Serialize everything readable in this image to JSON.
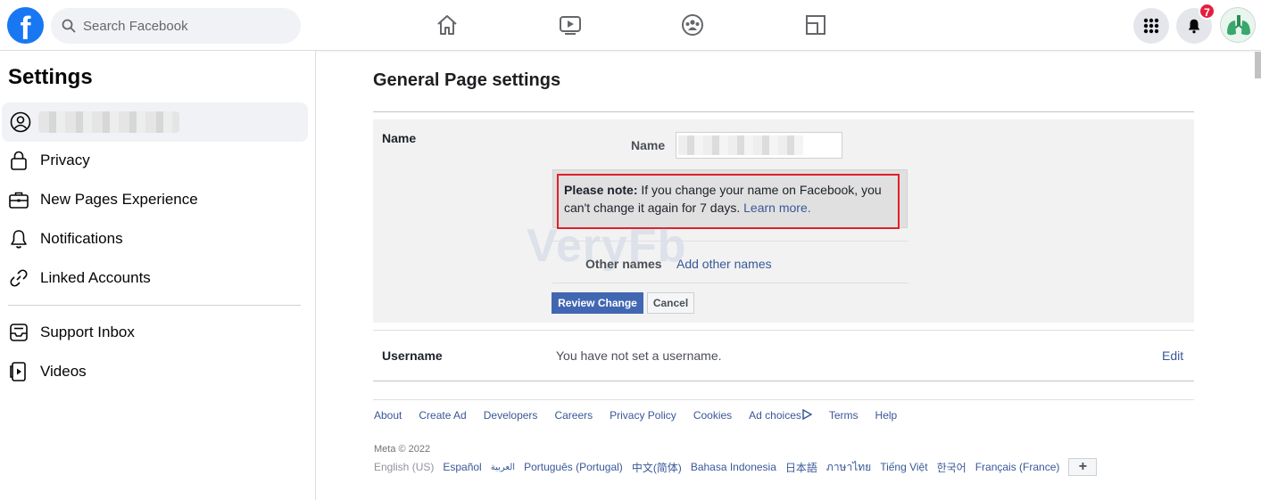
{
  "topbar": {
    "logo": "f",
    "search_placeholder": "Search Facebook",
    "notification_count": "7",
    "icons": [
      "home-icon",
      "watch-icon",
      "groups-icon",
      "gaming-icon",
      "menu-grid-icon",
      "bell-icon"
    ]
  },
  "sidebar": {
    "title": "Settings",
    "items": [
      {
        "label": "",
        "icon": "profile-icon",
        "active": true
      },
      {
        "label": "Privacy",
        "icon": "lock-icon"
      },
      {
        "label": "New Pages Experience",
        "icon": "briefcase-icon"
      },
      {
        "label": "Notifications",
        "icon": "bell-icon"
      },
      {
        "label": "Linked Accounts",
        "icon": "link-icon"
      },
      {
        "label": "Support Inbox",
        "icon": "inbox-icon"
      },
      {
        "label": "Videos",
        "icon": "video-icon"
      }
    ]
  },
  "main": {
    "title": "General Page settings",
    "name_section": {
      "label": "Name",
      "field_label": "Name",
      "note_bold": "Please note:",
      "note_text": " If you change your name on Facebook, you can't change it again for 7 days. ",
      "note_link": "Learn more.",
      "other_names_label": "Other names",
      "other_names_link": "Add other names",
      "review_button": "Review Change",
      "cancel_button": "Cancel"
    },
    "username_section": {
      "label": "Username",
      "value": "You have not set a username.",
      "edit_link": "Edit"
    },
    "watermark": "VeryFb"
  },
  "footer": {
    "links": [
      "About",
      "Create Ad",
      "Developers",
      "Careers",
      "Privacy Policy",
      "Cookies",
      "Ad choices",
      "Terms",
      "Help"
    ],
    "copyright": "Meta © 2022",
    "current_language": "English (US)",
    "languages": [
      "Español",
      "العربية",
      "Português (Portugal)",
      "中文(简体)",
      "Bahasa Indonesia",
      "日本語",
      "ภาษาไทย",
      "Tiếng Việt",
      "한국어",
      "Français (France)"
    ],
    "more_languages": "+"
  },
  "colors": {
    "brand": "#1877f2",
    "link": "#385898",
    "primary_button": "#4267b2",
    "highlight_outline": "#e0202a",
    "badge": "#e41e3f"
  }
}
